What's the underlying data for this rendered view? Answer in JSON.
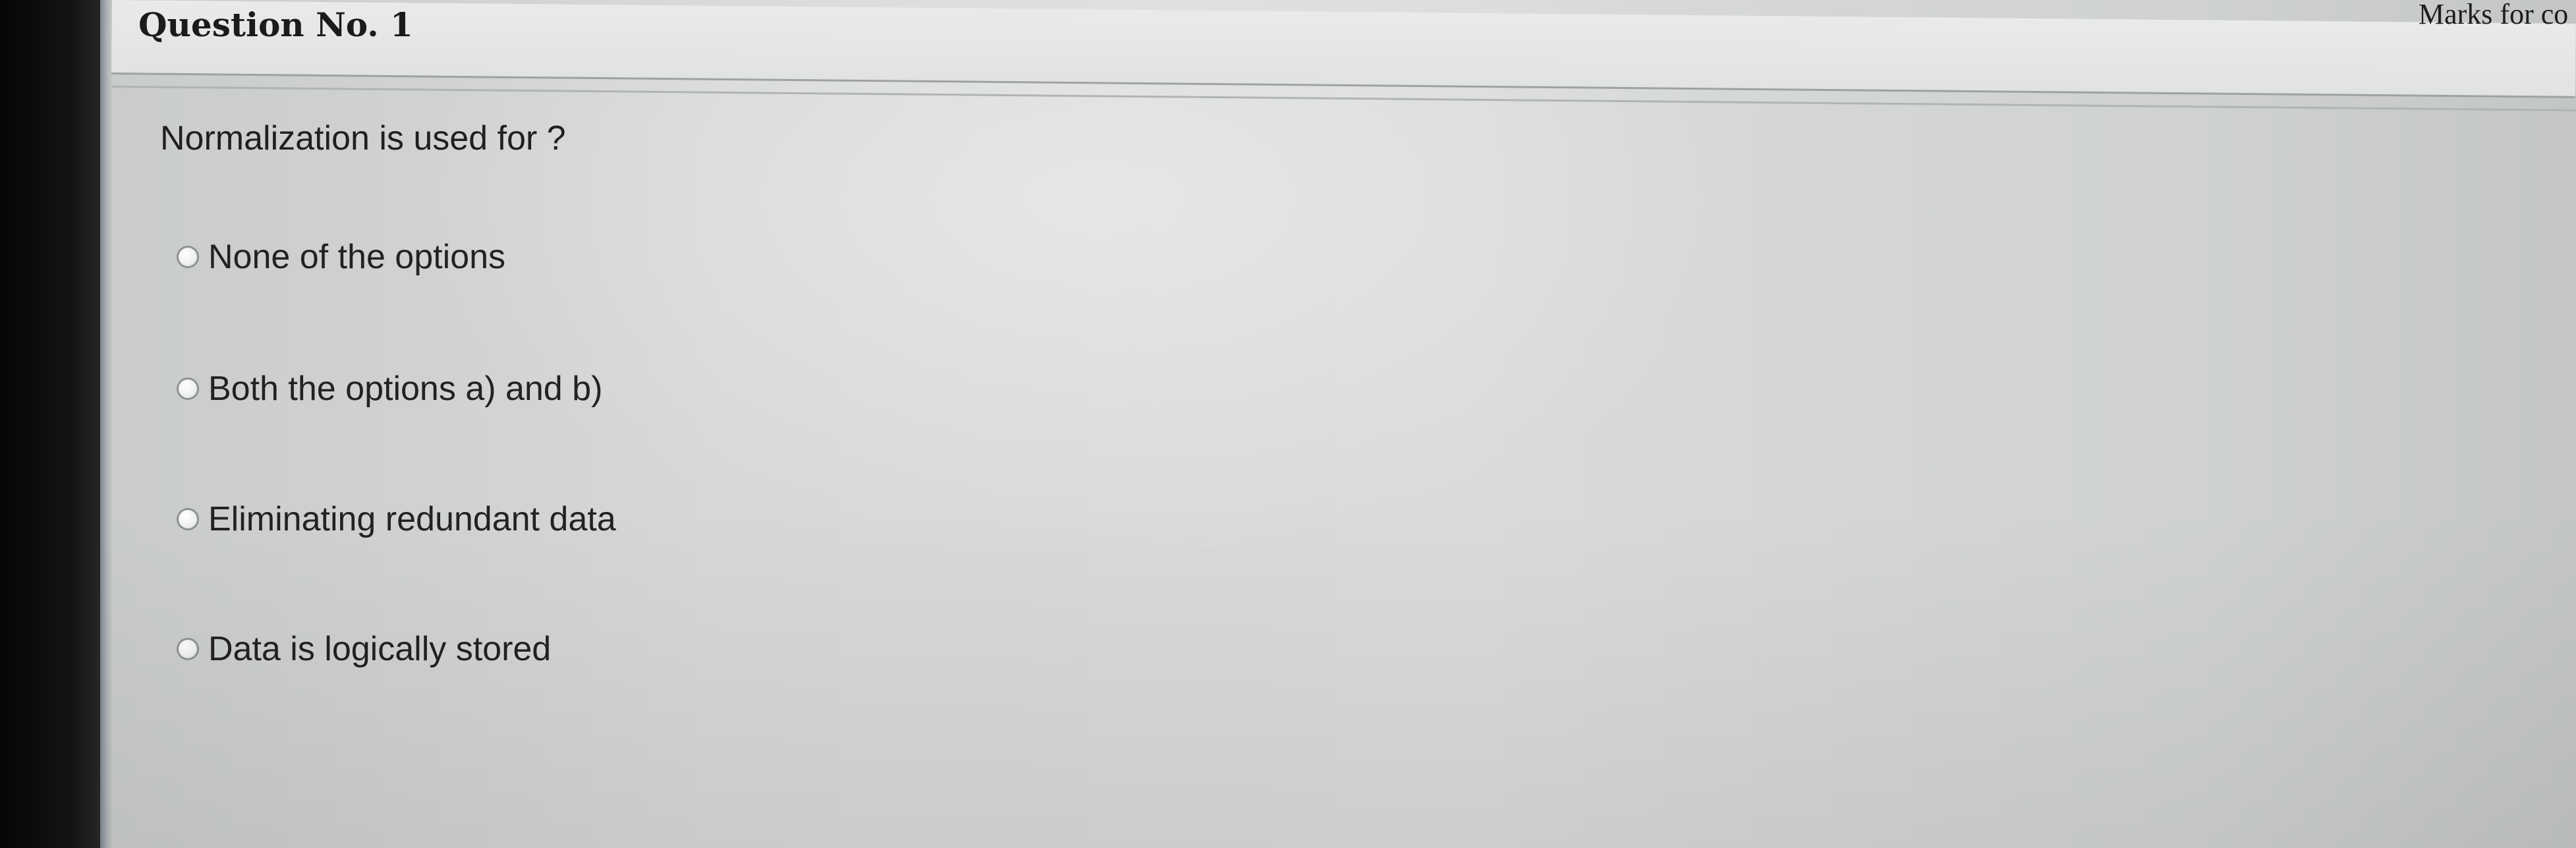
{
  "header": {
    "question_title": "Question No. 1",
    "marks_label": "Marks for co"
  },
  "question": {
    "text": "Normalization is used for ?"
  },
  "options": [
    {
      "label": "None of the options",
      "selected": false
    },
    {
      "label": "Both the options a) and b)",
      "selected": false
    },
    {
      "label": "Eliminating redundant data",
      "selected": false
    },
    {
      "label": "Data is logically stored",
      "selected": false
    }
  ]
}
